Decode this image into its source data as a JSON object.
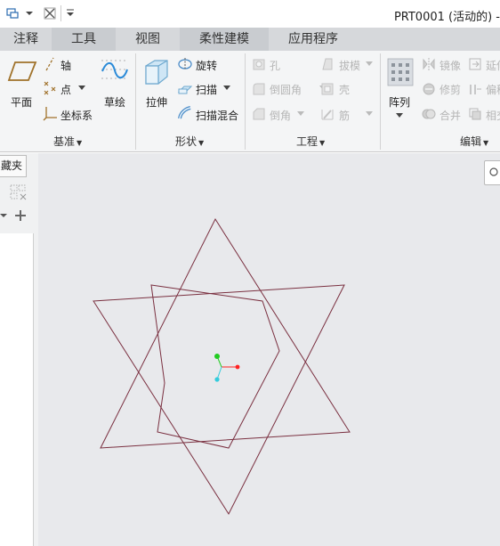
{
  "window": {
    "title": "PRT0001 (活动的) -"
  },
  "quick_access": {
    "icons": [
      "window-switch-icon",
      "dropdown-icon",
      "close-window-icon",
      "customize-icon"
    ]
  },
  "tabs": [
    {
      "label": "注释"
    },
    {
      "label": "工具"
    },
    {
      "label": "视图"
    },
    {
      "label": "柔性建模"
    },
    {
      "label": "应用程序"
    }
  ],
  "ribbon": {
    "datum": {
      "label": "基准",
      "plane": "平面",
      "axis": "轴",
      "point": "点",
      "csys": "坐标系",
      "sketch": "草绘"
    },
    "shapes": {
      "label": "形状",
      "extrude": "拉伸",
      "revolve": "旋转",
      "sweep": "扫描",
      "swept_blend": "扫描混合"
    },
    "engineering": {
      "label": "工程",
      "hole": "孔",
      "round": "倒圆角",
      "chamfer": "倒角",
      "draft": "拔模",
      "shell": "壳",
      "rib": "筋"
    },
    "editing": {
      "label": "编辑",
      "pattern": "阵列",
      "mirror": "镜像",
      "trim": "修剪",
      "merge": "合并",
      "extend": "延伸",
      "offset": "偏移",
      "intersect": "相交"
    }
  },
  "left_panel": {
    "tab_label": "藏夹"
  },
  "model": {
    "line_color": "#7a3040",
    "csys_x": "#ff2222",
    "csys_y": "#22cc22",
    "csys_z": "#33ccdd"
  }
}
